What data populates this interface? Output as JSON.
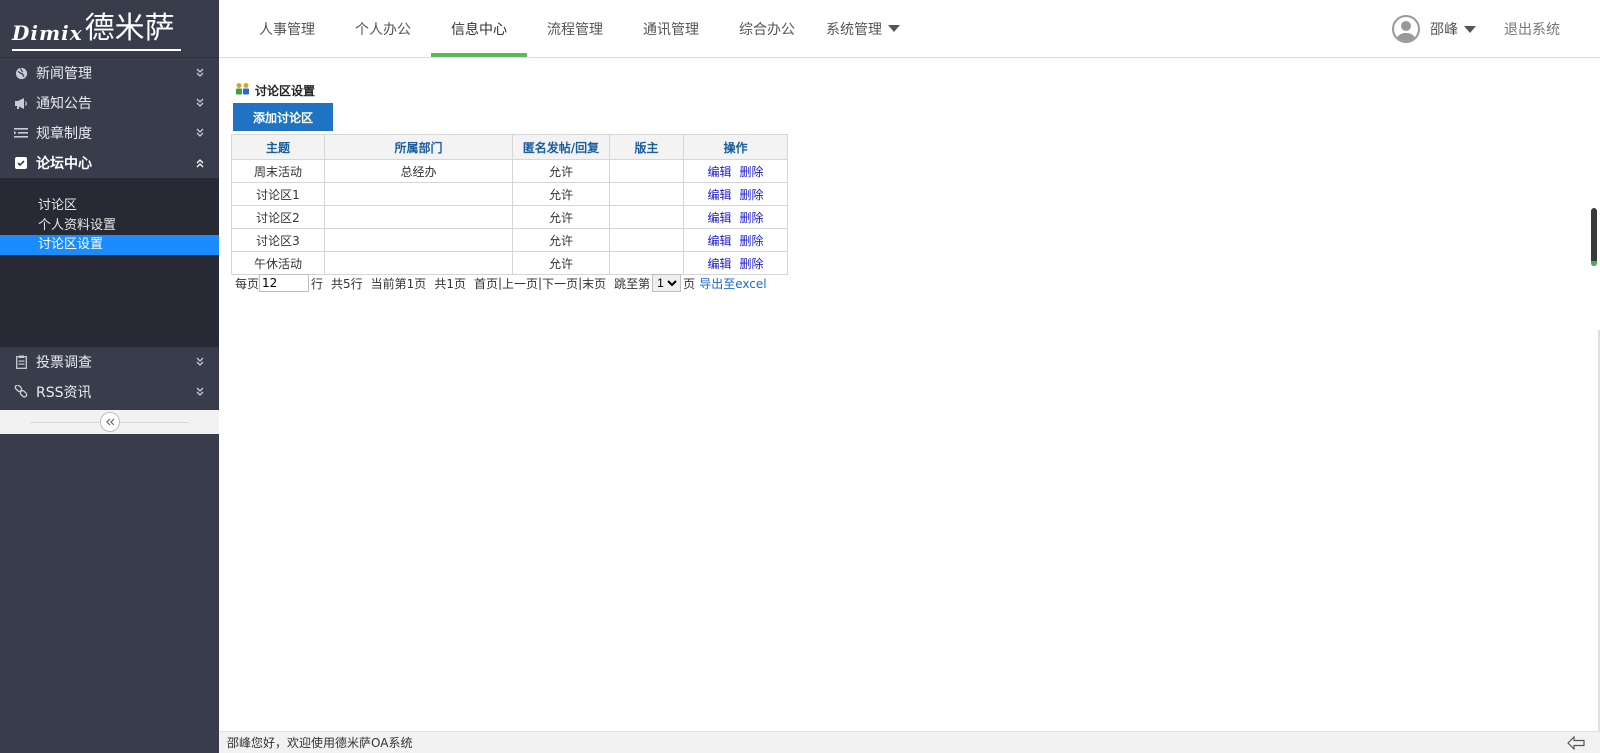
{
  "logo": {
    "en": "Dimix",
    "cn": "德米萨"
  },
  "sidebar": {
    "items": [
      {
        "label": "新闻管理",
        "icon": "globe-icon"
      },
      {
        "label": "通知公告",
        "icon": "megaphone-icon"
      },
      {
        "label": "规章制度",
        "icon": "list-icon"
      },
      {
        "label": "论坛中心",
        "icon": "checkbox-icon"
      },
      {
        "label": "投票调查",
        "icon": "clipboard-icon"
      },
      {
        "label": "RSS资讯",
        "icon": "link-icon"
      }
    ],
    "submenu": [
      "讨论区",
      "个人资料设置",
      "讨论区设置"
    ],
    "selected_sub": "讨论区设置"
  },
  "nav": {
    "items": [
      "人事管理",
      "个人办公",
      "信息中心",
      "流程管理",
      "通讯管理",
      "综合办公",
      "系统管理"
    ],
    "active": "信息中心"
  },
  "user": {
    "name": "邵峰",
    "logout": "退出系统"
  },
  "section": {
    "title": "讨论区设置",
    "add_button": "添加讨论区"
  },
  "table": {
    "headers": [
      "主题",
      "所属部门",
      "匿名发帖/回复",
      "版主",
      "操作"
    ],
    "rows": [
      {
        "topic": "周末活动",
        "dept": "总经办",
        "anon": "允许",
        "moderator": ""
      },
      {
        "topic": "讨论区1",
        "dept": "",
        "anon": "允许",
        "moderator": ""
      },
      {
        "topic": "讨论区2",
        "dept": "",
        "anon": "允许",
        "moderator": ""
      },
      {
        "topic": "讨论区3",
        "dept": "",
        "anon": "允许",
        "moderator": ""
      },
      {
        "topic": "午休活动",
        "dept": "",
        "anon": "允许",
        "moderator": ""
      }
    ],
    "edit_label": "编辑",
    "delete_label": "删除"
  },
  "pager": {
    "per_page_label": "每页",
    "per_page_value": "12",
    "rows_unit": "行",
    "total_rows": "共5行",
    "current_page": "当前第1页",
    "total_pages": "共1页",
    "first": "首页",
    "prev": "上一页",
    "next": "下一页",
    "last": "末页",
    "jump_label": "跳至第",
    "jump_value": "1",
    "page_unit": "页",
    "export": "导出至excel"
  },
  "footer": {
    "welcome": "邵峰您好，欢迎使用德米萨OA系统"
  },
  "colors": {
    "sidebar_bg": "#383c4b",
    "submenu_bg": "#272a34",
    "selected": "#1a8cff",
    "nav_active": "#5cb85c",
    "button": "#1f72c4"
  }
}
